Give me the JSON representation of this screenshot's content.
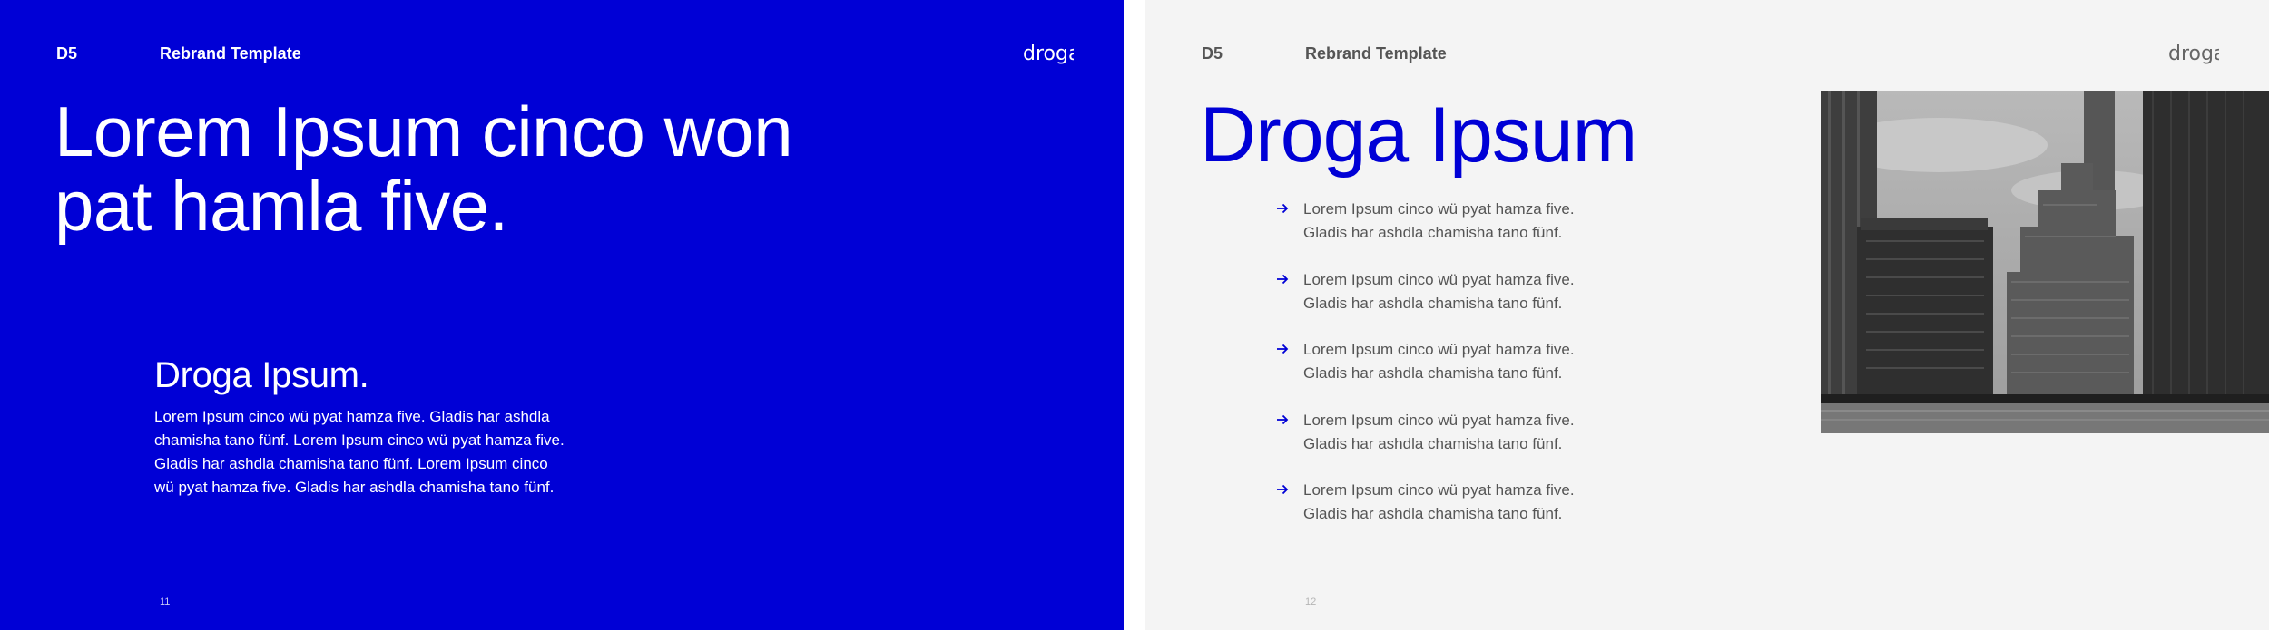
{
  "slide_left": {
    "code": "D5",
    "template_name": "Rebrand Template",
    "logo_text": "droga",
    "headline_line1": "Lorem Ipsum cinco won",
    "headline_line2": "pat hamla five.",
    "subhead": "Droga Ipsum.",
    "body_lines": [
      "Lorem Ipsum cinco wü pyat hamza five. Gladis har ashdla",
      "chamisha tano fünf. Lorem Ipsum cinco wü pyat hamza five.",
      "Gladis har ashdla chamisha tano fünf. Lorem Ipsum cinco",
      "wü pyat hamza five. Gladis har ashdla chamisha tano fünf."
    ],
    "page_number": "11"
  },
  "slide_right": {
    "code": "D5",
    "template_name": "Rebrand Template",
    "logo_text": "droga",
    "title": "Droga Ipsum",
    "bullets": [
      {
        "line1": "Lorem Ipsum cinco wü pyat hamza five.",
        "line2": "Gladis har ashdla chamisha tano fünf."
      },
      {
        "line1": "Lorem Ipsum cinco wü pyat hamza five.",
        "line2": "Gladis har ashdla chamisha tano fünf."
      },
      {
        "line1": "Lorem Ipsum cinco wü pyat hamza five.",
        "line2": "Gladis har ashdla chamisha tano fünf."
      },
      {
        "line1": "Lorem Ipsum cinco wü pyat hamza five.",
        "line2": "Gladis har ashdla chamisha tano fünf."
      },
      {
        "line1": "Lorem Ipsum cinco wü pyat hamza five.",
        "line2": "Gladis har ashdla chamisha tano fünf."
      }
    ],
    "page_number": "12"
  },
  "colors": {
    "brand_blue": "#0000d6",
    "right_background": "#f4f4f4",
    "body_gray": "#555555",
    "bullet_arrow": "#0000d6"
  },
  "icons": {
    "logo": "droga-logo",
    "bullet": "arrow-right-icon",
    "photo": "city-skyline-photo-grayscale"
  }
}
